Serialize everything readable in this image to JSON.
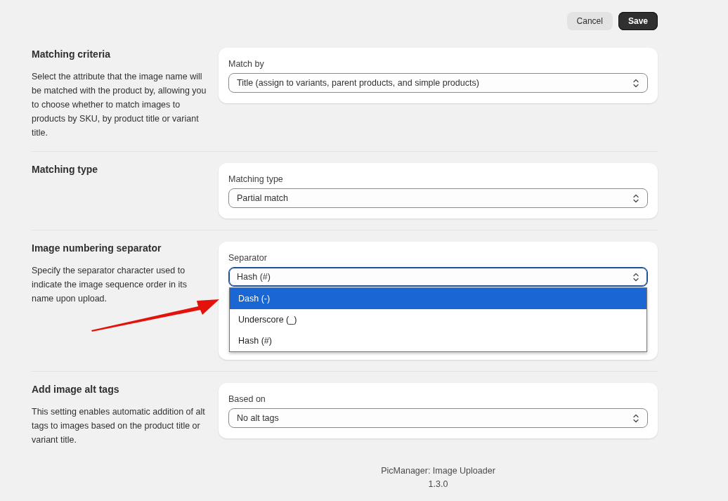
{
  "actions": [
    {
      "label": "Cancel",
      "kind": "secondary"
    },
    {
      "label": "Save",
      "kind": "primary"
    }
  ],
  "sections": [
    {
      "title": "Matching criteria",
      "description": "Select the attribute that the image name will be matched with the product by, allowing you to choose whether to match images to products by SKU, by product title or variant title.",
      "field": {
        "label": "Match by",
        "value": "Title (assign to variants, parent products, and simple products)",
        "focused": false
      }
    },
    {
      "title": "Matching type",
      "field": {
        "label": "Matching type",
        "value": "Partial match",
        "focused": false
      }
    },
    {
      "title": "Image numbering separator",
      "description": "Specify the separator character used to indicate the image sequence order in its name upon upload.",
      "field": {
        "label": "Separator",
        "value": "Hash (#)",
        "focused": true,
        "options": [
          {
            "label": "Dash (-)",
            "highlighted": true
          },
          {
            "label": "Underscore (_)",
            "highlighted": false
          },
          {
            "label": "Hash (#)",
            "highlighted": false
          }
        ]
      }
    },
    {
      "title": "Add image alt tags",
      "description": "This setting enables automatic addition of alt tags to images based on the product title or variant title.",
      "field": {
        "label": "Based on",
        "value": "No alt tags",
        "focused": false
      }
    }
  ],
  "footer": {
    "app_name": "PicManager: Image Uploader",
    "version": "1.3.0"
  }
}
